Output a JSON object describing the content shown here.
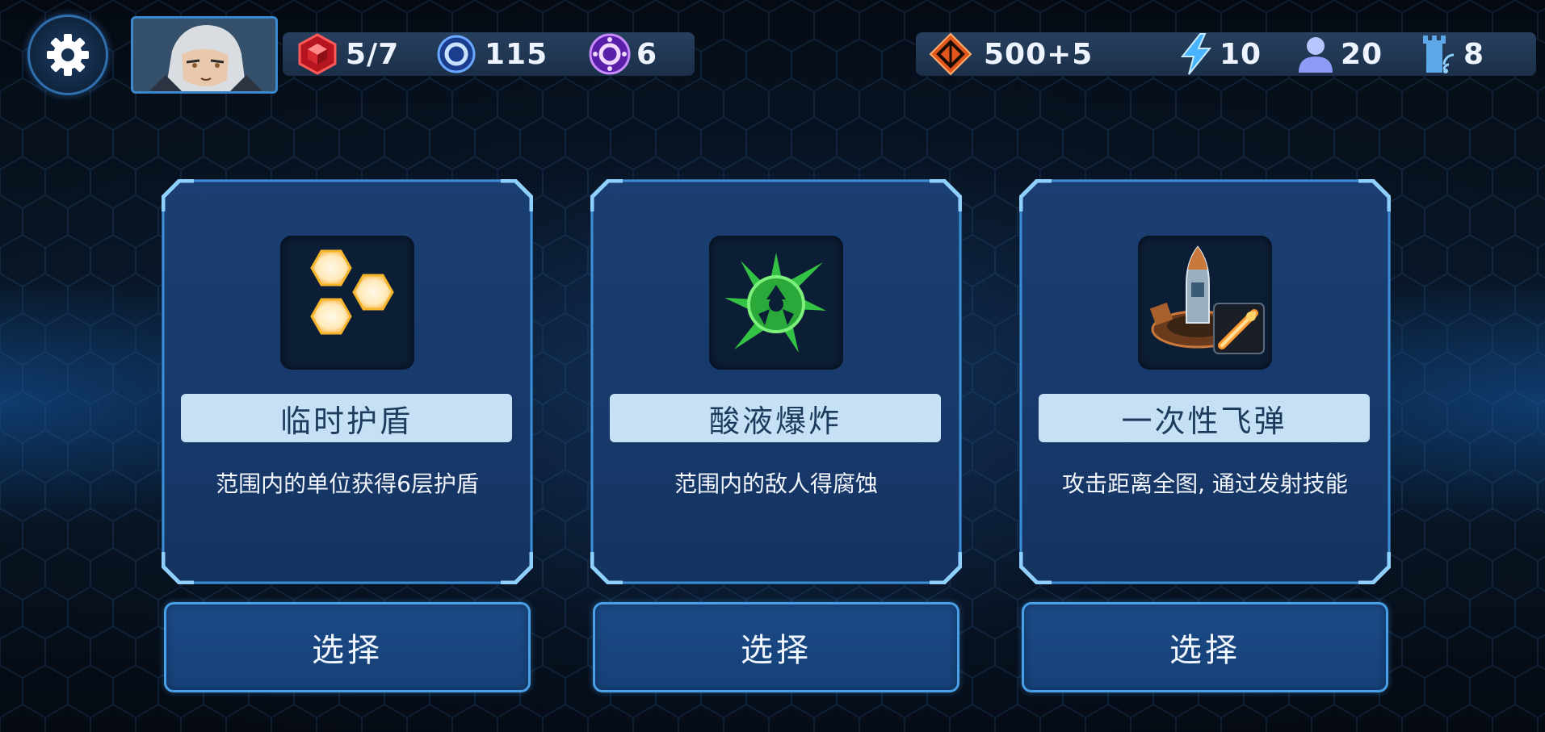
{
  "hud": {
    "settings_icon": "gear-icon",
    "avatar_icon": "commander-portrait",
    "left_resources": [
      {
        "icon": "red-cube-icon",
        "value": "5/7"
      },
      {
        "icon": "blue-ring-icon",
        "value": "115"
      },
      {
        "icon": "purple-orb-icon",
        "value": "6"
      }
    ],
    "right_resources": [
      {
        "icon": "orange-diamond-icon",
        "value": "500+5"
      },
      {
        "icon": "lightning-icon",
        "value": "10"
      },
      {
        "icon": "population-icon",
        "value": "20"
      },
      {
        "icon": "tower-signal-icon",
        "value": "8"
      }
    ]
  },
  "cards": [
    {
      "icon": "honeycomb-shield-icon",
      "title": "临时护盾",
      "description": "范围内的单位获得6层护盾",
      "select_label": "选择"
    },
    {
      "icon": "acid-burst-icon",
      "title": "酸液爆炸",
      "description": "范围内的敌人得腐蚀",
      "select_label": "选择"
    },
    {
      "icon": "missile-silo-icon",
      "title": "一次性飞弹",
      "description": "攻击距离全图, 通过发射技能",
      "select_label": "选择"
    }
  ],
  "colors": {
    "card_bg": "#17396a",
    "title_bar": "#c6e1f6",
    "accent_border": "#4aa0e8",
    "shield_gold": "#f5b52a",
    "acid_green": "#3ad14a"
  }
}
